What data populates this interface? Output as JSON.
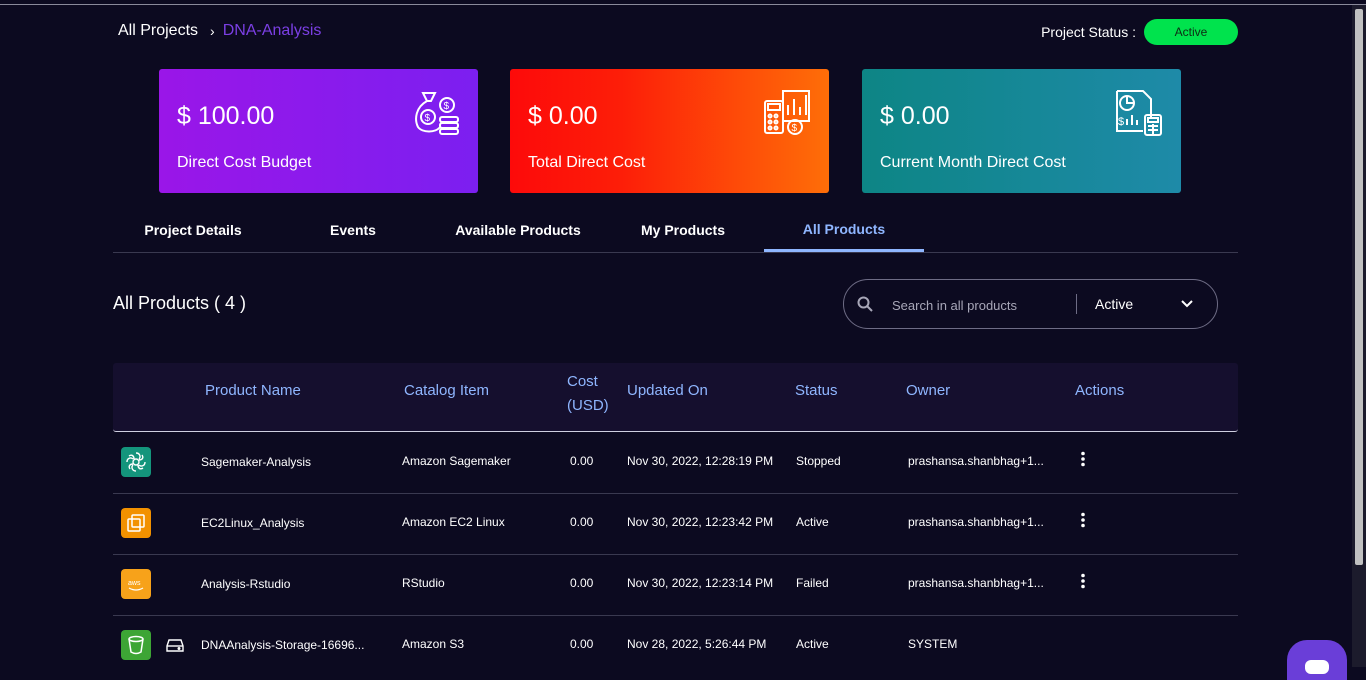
{
  "breadcrumb": {
    "root": "All Projects",
    "separator": "›",
    "current": "DNA-Analysis"
  },
  "project_status": {
    "label": "Project Status :",
    "value": "Active",
    "color": "#00e34d"
  },
  "cards": [
    {
      "amount": "$ 100.00",
      "label": "Direct Cost Budget",
      "icon": "money-bag-icon"
    },
    {
      "amount": "$ 0.00",
      "label": "Total Direct Cost",
      "icon": "cost-calculator-icon"
    },
    {
      "amount": "$ 0.00",
      "label": "Current Month Direct Cost",
      "icon": "monthly-report-icon"
    }
  ],
  "tabs": [
    "Project Details",
    "Events",
    "Available Products",
    "My Products",
    "All Products"
  ],
  "active_tab": "All Products",
  "section_title": "All Products ( 4 )",
  "search": {
    "placeholder": "Search in all products",
    "filter": "Active"
  },
  "table": {
    "headers": [
      "Product Name",
      "Catalog Item",
      "Cost (USD)",
      "Updated On",
      "Status",
      "Owner",
      "Actions"
    ],
    "rows": [
      {
        "icon": "sagemaker-icon",
        "name": "Sagemaker-Analysis",
        "catalog": "Amazon Sagemaker",
        "cost": "0.00",
        "updated": "Nov 30, 2022, 12:28:19 PM",
        "status": "Stopped",
        "owner": "prashansa.shanbhag+1..."
      },
      {
        "icon": "ec2-icon",
        "name": "EC2Linux_Analysis",
        "catalog": "Amazon EC2 Linux",
        "cost": "0.00",
        "updated": "Nov 30, 2022, 12:23:42 PM",
        "status": "Active",
        "owner": "prashansa.shanbhag+1..."
      },
      {
        "icon": "aws-icon",
        "name": "Analysis-Rstudio",
        "catalog": "RStudio",
        "cost": "0.00",
        "updated": "Nov 30, 2022, 12:23:14 PM",
        "status": "Failed",
        "owner": "prashansa.shanbhag+1..."
      },
      {
        "icon": "s3-bucket-icon",
        "name": "DNAAnalysis-Storage-16696...",
        "catalog": "Amazon S3",
        "cost": "0.00",
        "updated": "Nov 28, 2022, 5:26:44 PM",
        "status": "Active",
        "owner": "SYSTEM"
      }
    ]
  },
  "colors": {
    "accent": "#8fb6ff",
    "breadcrumb_current": "#7b3fe4",
    "background": "#0c0a20"
  }
}
